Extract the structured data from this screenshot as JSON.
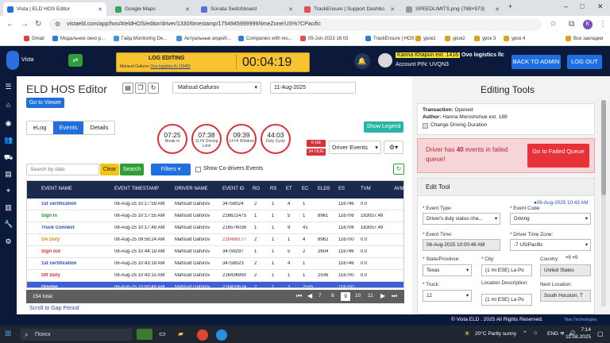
{
  "browser": {
    "tabs": [
      {
        "title": "Vista | ELD HOS Editor",
        "active": true
      },
      {
        "title": "Google Maps",
        "active": false
      },
      {
        "title": "Sonata Switchboard",
        "active": false
      },
      {
        "title": "TrackEnsure | Support Dashbo",
        "active": false
      },
      {
        "title": "SPEEDLIMITS.png (788×973)",
        "active": false
      }
    ],
    "url": "vistaeld.com/app/hos/#/eldHOS/editor/driver/1330/timestamp/1754945999999/timeZone/US%7CPacific",
    "bookmarks": [
      "Gmail",
      "Модальное окно р...",
      "Гайд Monitoring De...",
      "Актуальные апдейт...",
      "Companies with res...",
      "05-Jun-2023 16:03",
      "TrackEnsure | HOS",
      "урок1",
      "урок2",
      "урок 3",
      "урок 4"
    ],
    "all_bookmarks": "Все закладки"
  },
  "header": {
    "logo_text": "Vista",
    "log_editing_title": "LOG EDITING",
    "log_editing_sub": "Mahsud Gafurov",
    "log_editing_sub2": "Ovo logistics llc (1040)",
    "timer": "00:04:19",
    "user_name": "Karina Khapun ext. 1416",
    "company": "Ovo logistics llc",
    "account_pin": "Account PIN: UVQN3",
    "back_to_admin": "BACK TO ADMIN",
    "log_out": "LOG OUT"
  },
  "main": {
    "title": "ELD HOS Editor",
    "driver": "Mahsud Gafurov",
    "date": "11-Aug-2025",
    "go_to_viewer": "Go to Viewer",
    "tabs": [
      "eLog",
      "Events",
      "Details"
    ],
    "active_tab": "Events",
    "gauges": [
      {
        "value": "07:25",
        "label": "Break In"
      },
      {
        "value": "07:38",
        "label": "11 Hr Driving Limit"
      },
      {
        "value": "09:39",
        "label": "14 Hr Window"
      },
      {
        "value": "44:03",
        "label": "Duty Cycle"
      }
    ],
    "ue_badge": "0 UE",
    "oue_badge": "34 OUE",
    "driver_events": "Driver Events",
    "show_legend": "Show Legend",
    "search_placeholder": "Search by date",
    "clear": "Clear",
    "search": "Search",
    "filters": "Filters",
    "show_codrivers": "Show Co-drivers Events",
    "scroll_to_gap": "Scroll to Gap Period"
  },
  "table": {
    "columns": [
      "EVENT NAME",
      "EVENT TIMESTAMP",
      "DRIVER NAME",
      "EVENT ID",
      "RO",
      "RS",
      "ET",
      "EC",
      "ELDS",
      "ES",
      "TVM",
      "AVM"
    ],
    "rows": [
      {
        "name": "1st certification",
        "ts": "08-Aug-25 10:17:59 AM",
        "driver": "Mahsud Gafurov",
        "id": "34758024",
        "ro": "2",
        "rs": "1",
        "et": "4",
        "ec": "1",
        "elds": "",
        "es": "116746",
        "tvm": "0.0",
        "avm": "",
        "color": "#1f4fbf",
        "idcolor": "#222"
      },
      {
        "name": "Sign in",
        "ts": "08-Aug-25 10:17:55 AM",
        "driver": "Mahsud Gafurov",
        "id": "216621475",
        "ro": "1",
        "rs": "1",
        "et": "5",
        "ec": "1",
        "elds": "8961",
        "es": "116706",
        "tvm": "183057.49",
        "avm": "",
        "color": "#2e8b2e",
        "idcolor": "#222"
      },
      {
        "name": "Truck Connect",
        "ts": "08-Aug-25 10:17:48 AM",
        "driver": "Mahsud Gafurov",
        "id": "216574036",
        "ro": "1",
        "rs": "1",
        "et": "9",
        "ec": "41",
        "elds": "",
        "es": "116706",
        "tvm": "183057.49",
        "avm": "",
        "color": "#1f4fbf",
        "idcolor": "#222"
      },
      {
        "name": "On Duty",
        "ts": "08-Aug-25 09:56:24 AM",
        "driver": "Mahsud Gafurov",
        "id": "216486177",
        "ro": "2",
        "rs": "1",
        "et": "1",
        "ec": "4",
        "elds": "8962",
        "es": "116700",
        "tvm": "0.0",
        "avm": "",
        "color": "#e08a00",
        "idcolor": "#d8323a"
      },
      {
        "name": "Sign out",
        "ts": "06-Aug-25 10:44:18 AM",
        "driver": "Mahsud Gafurov",
        "id": "34759297",
        "ro": "1",
        "rs": "1",
        "et": "5",
        "ec": "2",
        "elds": "2604",
        "es": "116746",
        "tvm": "0.0",
        "avm": "",
        "color": "#d8323a",
        "idcolor": "#222"
      },
      {
        "name": "1st certification",
        "ts": "06-Aug-25 10:43:19 AM",
        "driver": "Mahsud Gafurov",
        "id": "34758023",
        "ro": "2",
        "rs": "1",
        "et": "4",
        "ec": "1",
        "elds": "",
        "es": "116746",
        "tvm": "0.0",
        "avm": "",
        "color": "#1f4fbf",
        "idcolor": "#222"
      },
      {
        "name": "Off Duty",
        "ts": "06-Aug-25 10:43:15 AM",
        "driver": "Mahsud Gafurov",
        "id": "216436990",
        "ro": "2",
        "rs": "1",
        "et": "1",
        "ec": "1",
        "elds": "2536",
        "es": "116700",
        "tvm": "0.0",
        "avm": "",
        "color": "#d8323a",
        "idcolor": "#222"
      },
      {
        "name": "Driving",
        "ts": "06-Aug-25 10:00:46 AM",
        "driver": "Mahsud Gafurov",
        "id": "216433674",
        "ro": "2",
        "rs": "1",
        "et": "3",
        "ec": "2535",
        "elds": "",
        "es": "116700",
        "tvm": "",
        "avm": "",
        "color": "#ffffff",
        "idcolor": "#ffffff"
      }
    ],
    "total": "154 total",
    "pages": [
      "7",
      "8",
      "9",
      "10",
      "11"
    ],
    "current_page": "9"
  },
  "tools": {
    "title": "Editing Tools",
    "transaction_label": "Transaction:",
    "transaction_value": "Opened",
    "author_label": "Author:",
    "author_value": "Hanna Moroshchuk ext. 189",
    "change_duration": "Change Driving Duration",
    "failed_text_pre": "Driver has ",
    "failed_count": "40",
    "failed_text_post": " events in failed queue!",
    "go_failed": "Go to Failed Queue",
    "edit_tool": "Edit Tool",
    "edit_time": "06-Aug-2025 10:43 AM",
    "event_type_label": "* Event Type:",
    "event_type_value": "Driver's duty status cha...",
    "event_code_label": "* Event Code:",
    "event_code_value": "Driving",
    "event_time_label": "* Event Time:",
    "event_time_value": "06-Aug-2025 10:00:46 AM",
    "tz_label": "* Driver Time Zone:",
    "tz_value": "-7 US/Pacific",
    "state_label": "* State/Province:",
    "state_value": "Texas",
    "city_label": "* City:",
    "city_value": "(1 mi ESE) La Po",
    "country_label": "Country:",
    "country_value": "United States",
    "truck_label": "* Truck:",
    "truck_value": "12",
    "loc_label": "Location Description:",
    "loc_value": "(1 mi ESE) La Po",
    "next_loc_label": "Next Location:",
    "next_loc_value": "South Houston, T"
  },
  "footer": {
    "copyright": "© Vista ELD . 2025 All Rights Reserved.",
    "titan": "Titan Technologies"
  },
  "taskbar": {
    "search": "Поиск",
    "weather": "20°C  Partly sunny",
    "lang": "ENG",
    "time": "7:14",
    "date": "11.08.2025"
  }
}
